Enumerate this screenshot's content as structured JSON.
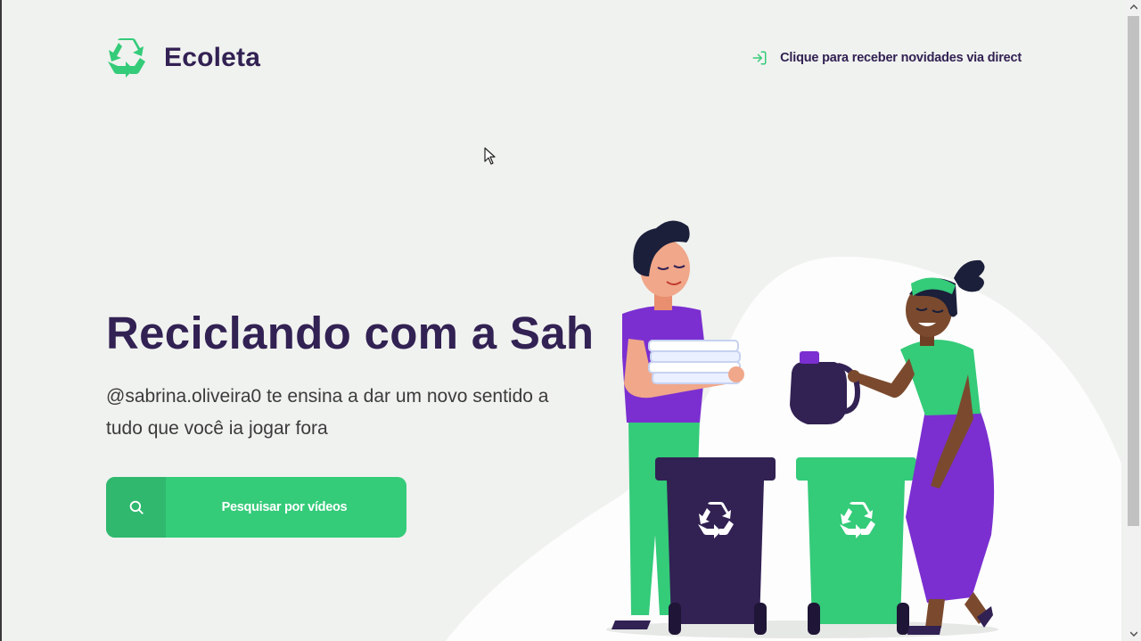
{
  "brand": {
    "name": "Ecoleta",
    "icon": "recycle-icon",
    "color": "#34cb79"
  },
  "header": {
    "direct_link": {
      "label": "Clique para receber novidades via direct",
      "icon": "log-in-icon"
    }
  },
  "hero": {
    "title": "Reciclando com a Sah",
    "description": "@sabrina.oliveira0 te ensina a dar um novo sentido a tudo que você ia jogar fora",
    "search_button": {
      "label": "Pesquisar por vídeos",
      "icon": "search-icon"
    }
  },
  "colors": {
    "primary": "#34cb79",
    "primary_dark": "#2fb86e",
    "title": "#322153",
    "text": "#3b3b3b",
    "background": "#f0f2ef"
  }
}
